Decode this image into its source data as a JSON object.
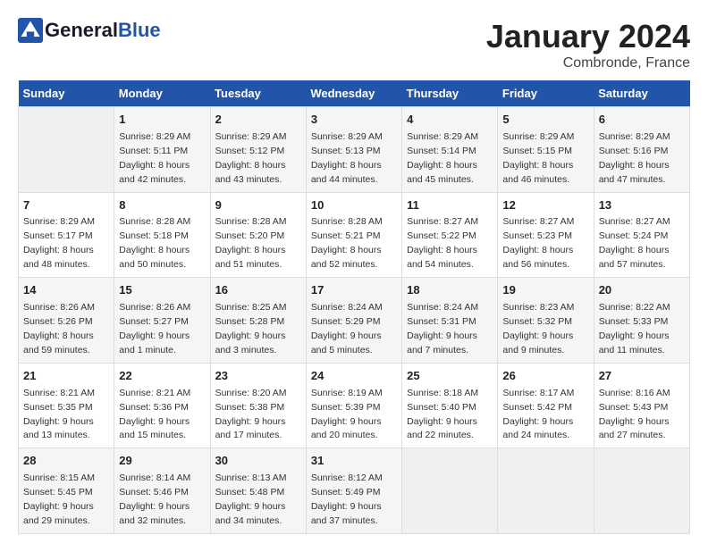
{
  "header": {
    "logo_general": "General",
    "logo_blue": "Blue",
    "month_year": "January 2024",
    "location": "Combronde, France"
  },
  "days_of_week": [
    "Sunday",
    "Monday",
    "Tuesday",
    "Wednesday",
    "Thursday",
    "Friday",
    "Saturday"
  ],
  "weeks": [
    [
      {
        "day": "",
        "empty": true
      },
      {
        "day": "1",
        "sunrise": "Sunrise: 8:29 AM",
        "sunset": "Sunset: 5:11 PM",
        "daylight": "Daylight: 8 hours and 42 minutes."
      },
      {
        "day": "2",
        "sunrise": "Sunrise: 8:29 AM",
        "sunset": "Sunset: 5:12 PM",
        "daylight": "Daylight: 8 hours and 43 minutes."
      },
      {
        "day": "3",
        "sunrise": "Sunrise: 8:29 AM",
        "sunset": "Sunset: 5:13 PM",
        "daylight": "Daylight: 8 hours and 44 minutes."
      },
      {
        "day": "4",
        "sunrise": "Sunrise: 8:29 AM",
        "sunset": "Sunset: 5:14 PM",
        "daylight": "Daylight: 8 hours and 45 minutes."
      },
      {
        "day": "5",
        "sunrise": "Sunrise: 8:29 AM",
        "sunset": "Sunset: 5:15 PM",
        "daylight": "Daylight: 8 hours and 46 minutes."
      },
      {
        "day": "6",
        "sunrise": "Sunrise: 8:29 AM",
        "sunset": "Sunset: 5:16 PM",
        "daylight": "Daylight: 8 hours and 47 minutes."
      }
    ],
    [
      {
        "day": "7",
        "sunrise": "Sunrise: 8:29 AM",
        "sunset": "Sunset: 5:17 PM",
        "daylight": "Daylight: 8 hours and 48 minutes."
      },
      {
        "day": "8",
        "sunrise": "Sunrise: 8:28 AM",
        "sunset": "Sunset: 5:18 PM",
        "daylight": "Daylight: 8 hours and 50 minutes."
      },
      {
        "day": "9",
        "sunrise": "Sunrise: 8:28 AM",
        "sunset": "Sunset: 5:20 PM",
        "daylight": "Daylight: 8 hours and 51 minutes."
      },
      {
        "day": "10",
        "sunrise": "Sunrise: 8:28 AM",
        "sunset": "Sunset: 5:21 PM",
        "daylight": "Daylight: 8 hours and 52 minutes."
      },
      {
        "day": "11",
        "sunrise": "Sunrise: 8:27 AM",
        "sunset": "Sunset: 5:22 PM",
        "daylight": "Daylight: 8 hours and 54 minutes."
      },
      {
        "day": "12",
        "sunrise": "Sunrise: 8:27 AM",
        "sunset": "Sunset: 5:23 PM",
        "daylight": "Daylight: 8 hours and 56 minutes."
      },
      {
        "day": "13",
        "sunrise": "Sunrise: 8:27 AM",
        "sunset": "Sunset: 5:24 PM",
        "daylight": "Daylight: 8 hours and 57 minutes."
      }
    ],
    [
      {
        "day": "14",
        "sunrise": "Sunrise: 8:26 AM",
        "sunset": "Sunset: 5:26 PM",
        "daylight": "Daylight: 8 hours and 59 minutes."
      },
      {
        "day": "15",
        "sunrise": "Sunrise: 8:26 AM",
        "sunset": "Sunset: 5:27 PM",
        "daylight": "Daylight: 9 hours and 1 minute."
      },
      {
        "day": "16",
        "sunrise": "Sunrise: 8:25 AM",
        "sunset": "Sunset: 5:28 PM",
        "daylight": "Daylight: 9 hours and 3 minutes."
      },
      {
        "day": "17",
        "sunrise": "Sunrise: 8:24 AM",
        "sunset": "Sunset: 5:29 PM",
        "daylight": "Daylight: 9 hours and 5 minutes."
      },
      {
        "day": "18",
        "sunrise": "Sunrise: 8:24 AM",
        "sunset": "Sunset: 5:31 PM",
        "daylight": "Daylight: 9 hours and 7 minutes."
      },
      {
        "day": "19",
        "sunrise": "Sunrise: 8:23 AM",
        "sunset": "Sunset: 5:32 PM",
        "daylight": "Daylight: 9 hours and 9 minutes."
      },
      {
        "day": "20",
        "sunrise": "Sunrise: 8:22 AM",
        "sunset": "Sunset: 5:33 PM",
        "daylight": "Daylight: 9 hours and 11 minutes."
      }
    ],
    [
      {
        "day": "21",
        "sunrise": "Sunrise: 8:21 AM",
        "sunset": "Sunset: 5:35 PM",
        "daylight": "Daylight: 9 hours and 13 minutes."
      },
      {
        "day": "22",
        "sunrise": "Sunrise: 8:21 AM",
        "sunset": "Sunset: 5:36 PM",
        "daylight": "Daylight: 9 hours and 15 minutes."
      },
      {
        "day": "23",
        "sunrise": "Sunrise: 8:20 AM",
        "sunset": "Sunset: 5:38 PM",
        "daylight": "Daylight: 9 hours and 17 minutes."
      },
      {
        "day": "24",
        "sunrise": "Sunrise: 8:19 AM",
        "sunset": "Sunset: 5:39 PM",
        "daylight": "Daylight: 9 hours and 20 minutes."
      },
      {
        "day": "25",
        "sunrise": "Sunrise: 8:18 AM",
        "sunset": "Sunset: 5:40 PM",
        "daylight": "Daylight: 9 hours and 22 minutes."
      },
      {
        "day": "26",
        "sunrise": "Sunrise: 8:17 AM",
        "sunset": "Sunset: 5:42 PM",
        "daylight": "Daylight: 9 hours and 24 minutes."
      },
      {
        "day": "27",
        "sunrise": "Sunrise: 8:16 AM",
        "sunset": "Sunset: 5:43 PM",
        "daylight": "Daylight: 9 hours and 27 minutes."
      }
    ],
    [
      {
        "day": "28",
        "sunrise": "Sunrise: 8:15 AM",
        "sunset": "Sunset: 5:45 PM",
        "daylight": "Daylight: 9 hours and 29 minutes."
      },
      {
        "day": "29",
        "sunrise": "Sunrise: 8:14 AM",
        "sunset": "Sunset: 5:46 PM",
        "daylight": "Daylight: 9 hours and 32 minutes."
      },
      {
        "day": "30",
        "sunrise": "Sunrise: 8:13 AM",
        "sunset": "Sunset: 5:48 PM",
        "daylight": "Daylight: 9 hours and 34 minutes."
      },
      {
        "day": "31",
        "sunrise": "Sunrise: 8:12 AM",
        "sunset": "Sunset: 5:49 PM",
        "daylight": "Daylight: 9 hours and 37 minutes."
      },
      {
        "day": "",
        "empty": true
      },
      {
        "day": "",
        "empty": true
      },
      {
        "day": "",
        "empty": true
      }
    ]
  ]
}
